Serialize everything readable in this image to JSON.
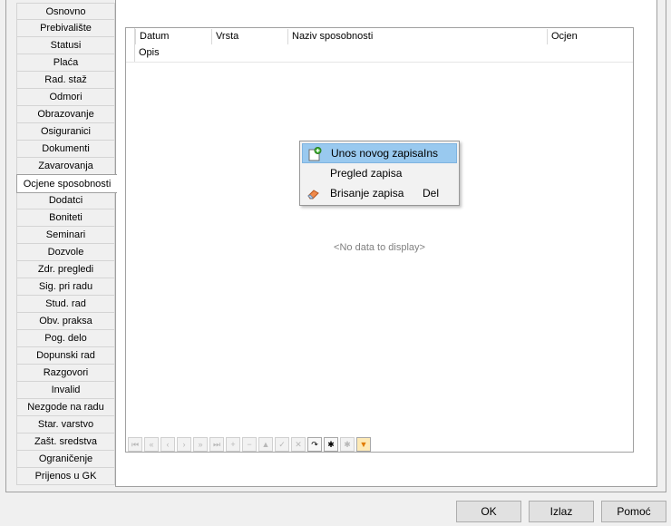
{
  "tabs": [
    {
      "label": "Osnovno"
    },
    {
      "label": "Prebivalište"
    },
    {
      "label": "Statusi"
    },
    {
      "label": "Plaća"
    },
    {
      "label": "Rad. staž"
    },
    {
      "label": "Odmori"
    },
    {
      "label": "Obrazovanje"
    },
    {
      "label": "Osiguranici"
    },
    {
      "label": "Dokumenti"
    },
    {
      "label": "Zavarovanja"
    },
    {
      "label": "Ocjene sposobnosti",
      "active": true
    },
    {
      "label": "Dodatci"
    },
    {
      "label": "Boniteti"
    },
    {
      "label": "Seminari"
    },
    {
      "label": "Dozvole"
    },
    {
      "label": "Zdr. pregledi"
    },
    {
      "label": "Sig. pri radu"
    },
    {
      "label": "Stud. rad"
    },
    {
      "label": "Obv. praksa"
    },
    {
      "label": "Pog. delo"
    },
    {
      "label": "Dopunski rad"
    },
    {
      "label": "Razgovori"
    },
    {
      "label": "Invalid"
    },
    {
      "label": "Nezgode na radu"
    },
    {
      "label": "Star. varstvo"
    },
    {
      "label": "Zašt. sredstva"
    },
    {
      "label": "Ograničenje"
    },
    {
      "label": "Prijenos u GK"
    }
  ],
  "grid": {
    "columns": [
      "Datum",
      "Vrsta",
      "Naziv sposobnosti",
      "Ocjen"
    ],
    "second_row_column": "Opis",
    "empty_message": "<No data to display>"
  },
  "navigator": {
    "buttons": [
      {
        "icon": "first-record-icon",
        "glyph": "⏮",
        "enabled": false
      },
      {
        "icon": "prev-page-icon",
        "glyph": "«",
        "enabled": false
      },
      {
        "icon": "prev-record-icon",
        "glyph": "‹",
        "enabled": false
      },
      {
        "icon": "next-record-icon",
        "glyph": "›",
        "enabled": false
      },
      {
        "icon": "next-page-icon",
        "glyph": "»",
        "enabled": false
      },
      {
        "icon": "last-record-icon",
        "glyph": "⏭",
        "enabled": false
      },
      {
        "icon": "insert-icon",
        "glyph": "+",
        "enabled": false
      },
      {
        "icon": "delete-icon",
        "glyph": "−",
        "enabled": false
      },
      {
        "icon": "edit-icon",
        "glyph": "▲",
        "enabled": false
      },
      {
        "icon": "post-icon",
        "glyph": "✓",
        "enabled": false
      },
      {
        "icon": "cancel-icon",
        "glyph": "✕",
        "enabled": false
      },
      {
        "icon": "refresh-icon",
        "glyph": "↷",
        "enabled": true
      },
      {
        "icon": "bookmark-icon",
        "glyph": "✱",
        "enabled": true
      },
      {
        "icon": "goto-bookmark-icon",
        "glyph": "✱",
        "enabled": false
      },
      {
        "icon": "filter-icon",
        "glyph": "▼",
        "enabled": true,
        "filter": true
      }
    ]
  },
  "context_menu": {
    "items": [
      {
        "label": "Unos novog zapisa",
        "shortcut": "Ins",
        "icon": "new-record-icon",
        "highlight": true
      },
      {
        "label": "Pregled zapisa",
        "shortcut": "",
        "icon": "",
        "highlight": false
      },
      {
        "label": "Brisanje zapisa",
        "shortcut": "Del",
        "icon": "eraser-icon",
        "highlight": false
      }
    ]
  },
  "buttons": {
    "ok": "OK",
    "izlaz": "Izlaz",
    "pomoc": "Pomoć"
  }
}
